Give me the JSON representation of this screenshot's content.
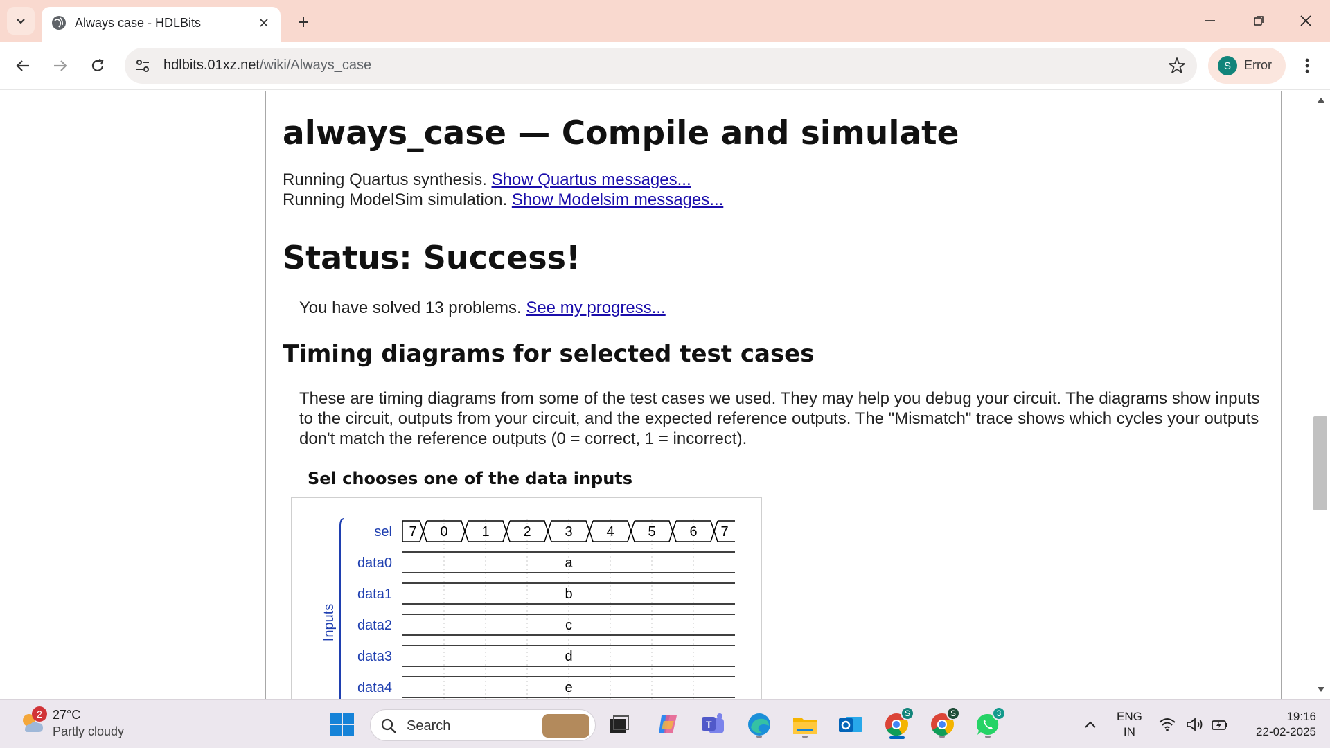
{
  "browser": {
    "tab_title": "Always case - HDLBits",
    "url_host": "hdlbits.01xz.net",
    "url_path": "/wiki/Always_case",
    "profile_initial": "S",
    "profile_label": "Error"
  },
  "page": {
    "heading": "always_case — Compile and simulate",
    "line1_text": "Running Quartus synthesis. ",
    "line1_link": "Show Quartus messages...",
    "line2_text": "Running ModelSim simulation. ",
    "line2_link": "Show Modelsim messages...",
    "status": "Status: Success!",
    "solved_text": "You have solved 13 problems. ",
    "solved_link": "See my progress...",
    "timing_heading": "Timing diagrams for selected test cases",
    "timing_para": "These are timing diagrams from some of the test cases we used. They may help you debug your circuit. The diagrams show inputs to the circuit, outputs from your circuit, and the expected reference outputs. The \"Mismatch\" trace shows which cycles your outputs don't match the reference outputs (0 = correct, 1 = incorrect).",
    "testcase_title": "Sel chooses one of the data inputs"
  },
  "waveform": {
    "group_label": "Inputs",
    "sel_label": "sel",
    "sel_values": [
      "7",
      "0",
      "1",
      "2",
      "3",
      "4",
      "5",
      "6",
      "7"
    ],
    "signals": [
      {
        "name": "data0",
        "value": "a"
      },
      {
        "name": "data1",
        "value": "b"
      },
      {
        "name": "data2",
        "value": "c"
      },
      {
        "name": "data3",
        "value": "d"
      },
      {
        "name": "data4",
        "value": "e"
      }
    ],
    "label_color": "#1f3fb0"
  },
  "taskbar": {
    "weather_temp": "27°C",
    "weather_desc": "Partly cloudy",
    "weather_badge": "2",
    "search_placeholder": "Search",
    "chrome_badge_1": "S",
    "chrome_badge_2": "S",
    "whatsapp_badge": "3",
    "lang_1": "ENG",
    "lang_2": "IN",
    "time": "19:16",
    "date": "22-02-2025"
  }
}
